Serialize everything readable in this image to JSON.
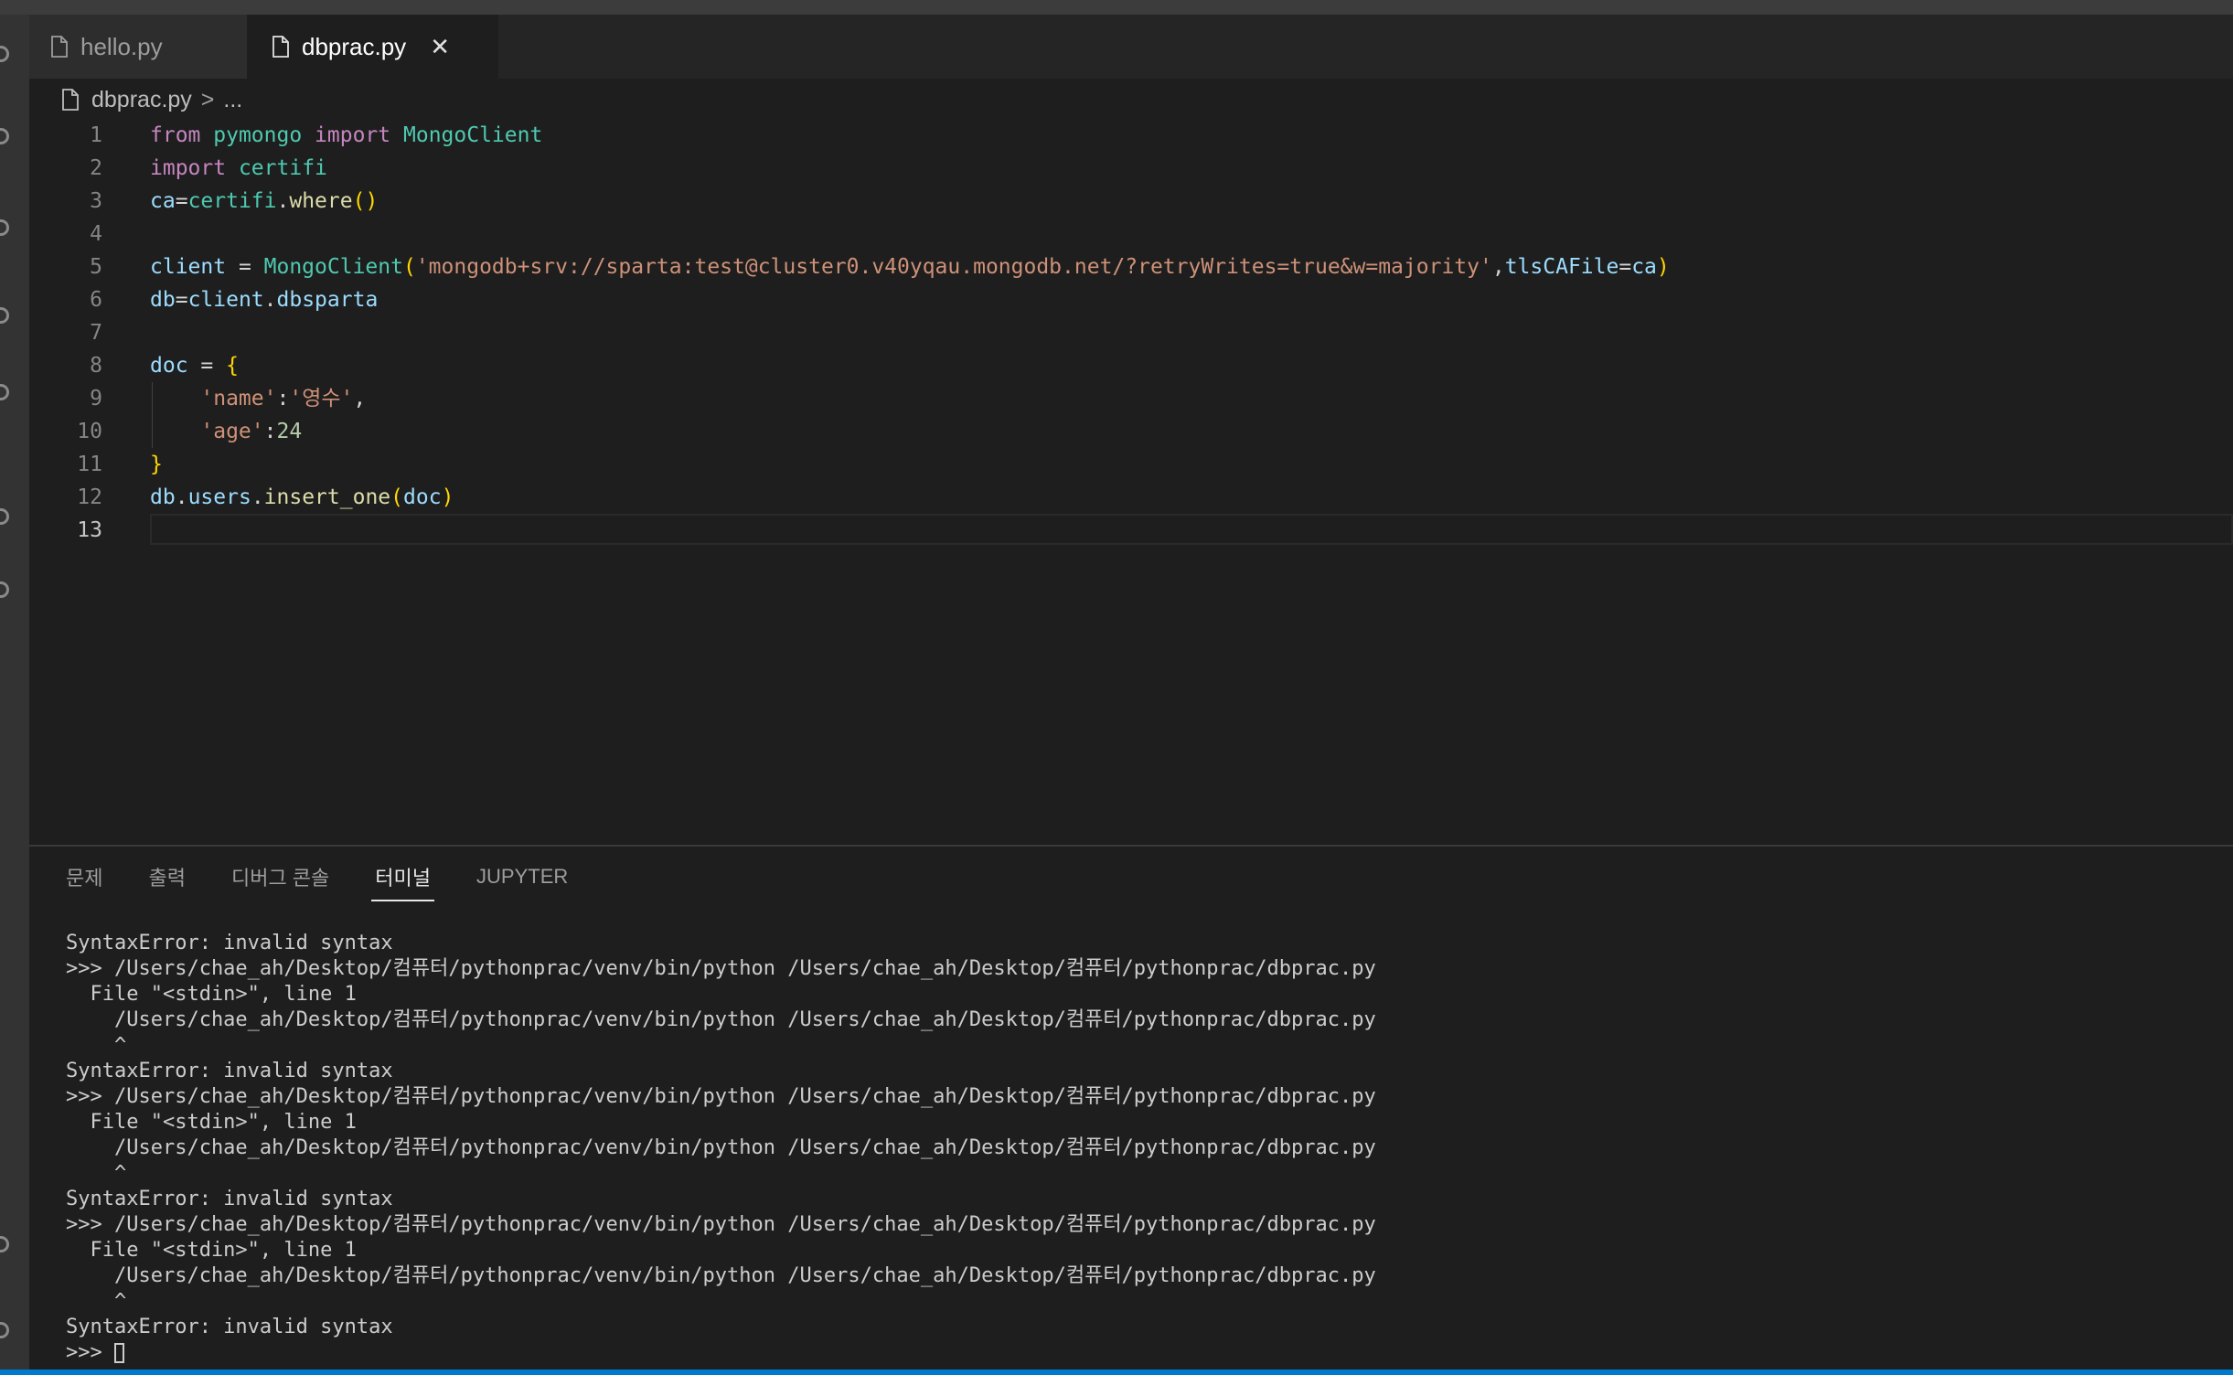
{
  "tabs": [
    {
      "label": "hello.py",
      "active": false
    },
    {
      "label": "dbprac.py",
      "active": true
    }
  ],
  "breadcrumb": {
    "file": "dbprac.py",
    "separator": ">",
    "rest": "..."
  },
  "editor": {
    "line_numbers": [
      "1",
      "2",
      "3",
      "4",
      "5",
      "6",
      "7",
      "8",
      "9",
      "10",
      "11",
      "12",
      "13"
    ],
    "current_line": 13,
    "lines": [
      [
        {
          "t": "from",
          "c": "kw"
        },
        {
          "t": " "
        },
        {
          "t": "pymongo",
          "c": "mod"
        },
        {
          "t": " "
        },
        {
          "t": "import",
          "c": "kw"
        },
        {
          "t": " "
        },
        {
          "t": "MongoClient",
          "c": "mod"
        }
      ],
      [
        {
          "t": "import",
          "c": "kw"
        },
        {
          "t": " "
        },
        {
          "t": "certifi",
          "c": "mod"
        }
      ],
      [
        {
          "t": "ca",
          "c": "var"
        },
        {
          "t": "=",
          "c": "op"
        },
        {
          "t": "certifi",
          "c": "mod"
        },
        {
          "t": ".",
          "c": "op"
        },
        {
          "t": "where",
          "c": "fn"
        },
        {
          "t": "()",
          "c": "br"
        }
      ],
      [],
      [
        {
          "t": "client",
          "c": "var"
        },
        {
          "t": " = ",
          "c": "op"
        },
        {
          "t": "MongoClient",
          "c": "mod"
        },
        {
          "t": "(",
          "c": "br"
        },
        {
          "t": "'mongodb+srv://sparta:test@cluster0.v40yqau.mongodb.net/?retryWrites=true&w=majority'",
          "c": "str"
        },
        {
          "t": ",",
          "c": "op"
        },
        {
          "t": "tlsCAFile",
          "c": "var"
        },
        {
          "t": "=",
          "c": "op"
        },
        {
          "t": "ca",
          "c": "var"
        },
        {
          "t": ")",
          "c": "br"
        }
      ],
      [
        {
          "t": "db",
          "c": "var"
        },
        {
          "t": "=",
          "c": "op"
        },
        {
          "t": "client",
          "c": "var"
        },
        {
          "t": ".",
          "c": "op"
        },
        {
          "t": "dbsparta",
          "c": "var"
        }
      ],
      [],
      [
        {
          "t": "doc",
          "c": "var"
        },
        {
          "t": " = ",
          "c": "op"
        },
        {
          "t": "{",
          "c": "br"
        }
      ],
      [
        {
          "t": "    "
        },
        {
          "t": "'name'",
          "c": "str"
        },
        {
          "t": ":",
          "c": "op"
        },
        {
          "t": "'영수'",
          "c": "str"
        },
        {
          "t": ",",
          "c": "op"
        }
      ],
      [
        {
          "t": "    "
        },
        {
          "t": "'age'",
          "c": "str"
        },
        {
          "t": ":",
          "c": "op"
        },
        {
          "t": "24",
          "c": "num"
        }
      ],
      [
        {
          "t": "}",
          "c": "br"
        }
      ],
      [
        {
          "t": "db",
          "c": "var"
        },
        {
          "t": ".",
          "c": "op"
        },
        {
          "t": "users",
          "c": "var"
        },
        {
          "t": ".",
          "c": "op"
        },
        {
          "t": "insert_one",
          "c": "fn"
        },
        {
          "t": "(",
          "c": "br"
        },
        {
          "t": "doc",
          "c": "var"
        },
        {
          "t": ")",
          "c": "br"
        }
      ],
      []
    ]
  },
  "panel": {
    "tabs": [
      {
        "label": "문제",
        "active": false
      },
      {
        "label": "출력",
        "active": false
      },
      {
        "label": "디버그 콘솔",
        "active": false
      },
      {
        "label": "터미널",
        "active": true
      },
      {
        "label": "JUPYTER",
        "active": false
      }
    ],
    "terminal_lines": [
      "SyntaxError: invalid syntax",
      ">>> /Users/chae_ah/Desktop/컴퓨터/pythonprac/venv/bin/python /Users/chae_ah/Desktop/컴퓨터/pythonprac/dbprac.py",
      "  File \"<stdin>\", line 1",
      "    /Users/chae_ah/Desktop/컴퓨터/pythonprac/venv/bin/python /Users/chae_ah/Desktop/컴퓨터/pythonprac/dbprac.py",
      "    ^",
      "SyntaxError: invalid syntax",
      ">>> /Users/chae_ah/Desktop/컴퓨터/pythonprac/venv/bin/python /Users/chae_ah/Desktop/컴퓨터/pythonprac/dbprac.py",
      "  File \"<stdin>\", line 1",
      "    /Users/chae_ah/Desktop/컴퓨터/pythonprac/venv/bin/python /Users/chae_ah/Desktop/컴퓨터/pythonprac/dbprac.py",
      "    ^",
      "SyntaxError: invalid syntax",
      ">>> /Users/chae_ah/Desktop/컴퓨터/pythonprac/venv/bin/python /Users/chae_ah/Desktop/컴퓨터/pythonprac/dbprac.py",
      "  File \"<stdin>\", line 1",
      "    /Users/chae_ah/Desktop/컴퓨터/pythonprac/venv/bin/python /Users/chae_ah/Desktop/컴퓨터/pythonprac/dbprac.py",
      "    ^",
      "SyntaxError: invalid syntax"
    ],
    "prompt": ">>> "
  },
  "colors": {
    "accent": "#007acc",
    "keyword": "#c586c0",
    "string": "#ce9178",
    "type": "#4ec9b0"
  }
}
